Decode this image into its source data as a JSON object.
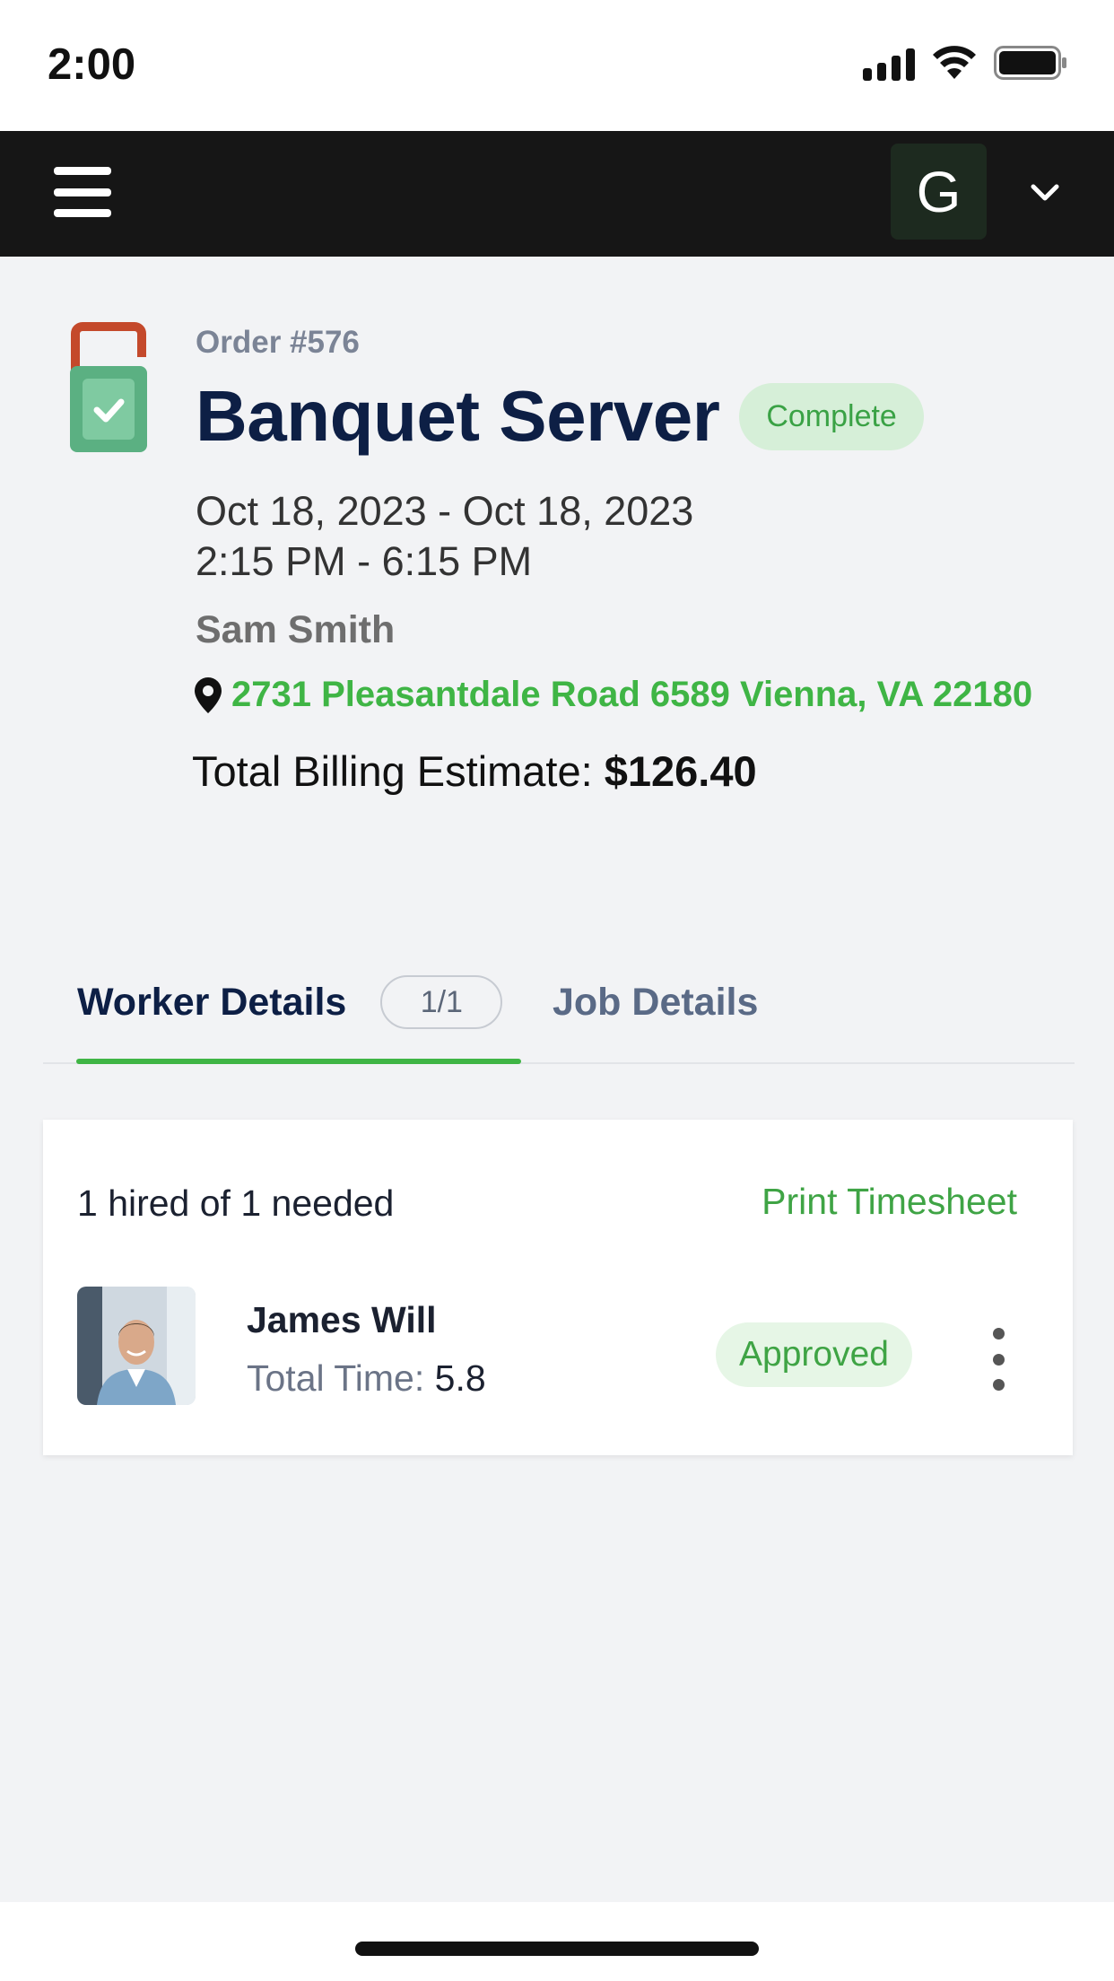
{
  "status_bar": {
    "time": "2:00"
  },
  "nav": {
    "avatar_letter": "G"
  },
  "order": {
    "number": "Order #576",
    "title": "Banquet Server",
    "status": "Complete",
    "date_range": "Oct 18, 2023 - Oct 18, 2023",
    "time_range": "2:15 PM - 6:15 PM",
    "contact": "Sam Smith",
    "address": "2731 Pleasantdale Road 6589 Vienna, VA 22180",
    "billing_label": "Total Billing Estimate:",
    "billing_value": "$126.40"
  },
  "tabs": {
    "worker_details": "Worker Details",
    "worker_count": "1/1",
    "job_details": "Job Details"
  },
  "card": {
    "hired_text": "1 hired of 1 needed",
    "print_label": "Print Timesheet",
    "worker": {
      "name": "James Will",
      "total_time_label": "Total Time:",
      "total_time_value": "5.8",
      "status": "Approved"
    }
  },
  "colors": {
    "accent_green": "#3fb545",
    "navy": "#0d1f45",
    "nav_bg": "#161616",
    "page_bg": "#f2f3f5"
  }
}
